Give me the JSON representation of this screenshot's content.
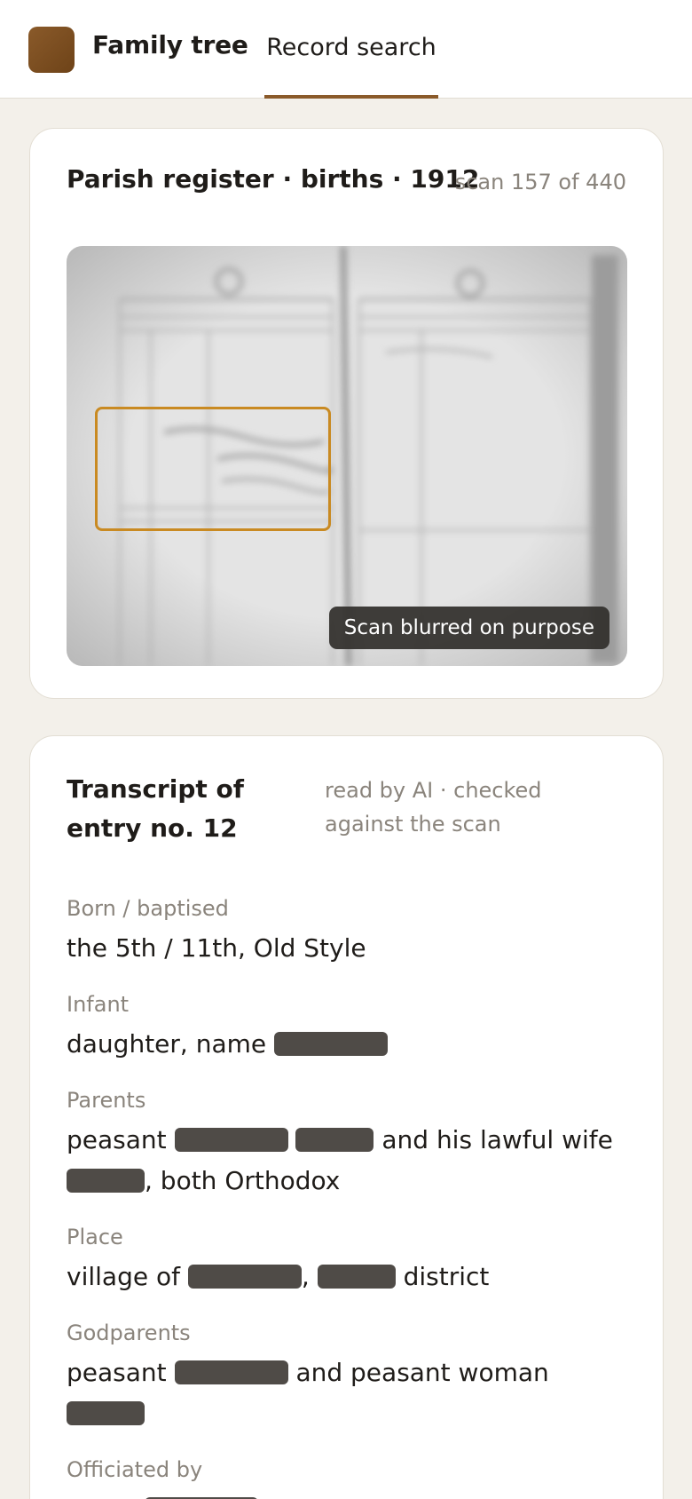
{
  "header": {
    "app_title": "Family tree",
    "active_tab": "Record search",
    "accent_color": "#8a5a2a",
    "logo": "family-tree-logo"
  },
  "scan_card": {
    "title": "Parish register · births · 1912",
    "scan_position": "scan 157 of 440",
    "blur_notice": "Scan blurred on purpose",
    "highlight_color": "#c98a22"
  },
  "transcript": {
    "title": "Transcript of entry no. 12",
    "meta": "read by AI · checked against the scan",
    "fields": [
      {
        "label": "Born / baptised",
        "value": "the 5th / 11th, Old Style"
      },
      {
        "label": "Infant",
        "value_prefix": "daughter, name"
      },
      {
        "label": "Parents",
        "value_a": "peasant",
        "value_b": "and his lawful wife",
        "value_c": ", both Orthodox"
      },
      {
        "label": "Place",
        "value_a": "village of",
        "value_b": ",",
        "value_c": "district"
      },
      {
        "label": "Godparents",
        "value_a": "peasant",
        "value_b": "and peasant woman"
      },
      {
        "label": "Officiated by"
      }
    ]
  }
}
